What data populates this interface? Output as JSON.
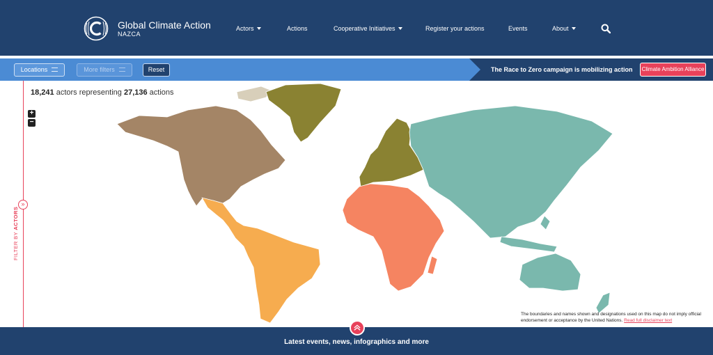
{
  "header": {
    "brand_title": "Global Climate Action",
    "brand_subtitle": "NAZCA",
    "nav": [
      {
        "label": "Actors",
        "dropdown": true
      },
      {
        "label": "Actions",
        "dropdown": false
      },
      {
        "label": "Cooperative Initiatives",
        "dropdown": true
      },
      {
        "label": "Register your actions",
        "dropdown": false
      },
      {
        "label": "Events",
        "dropdown": false
      },
      {
        "label": "About",
        "dropdown": true
      }
    ],
    "search_icon": "search-icon"
  },
  "filters": {
    "locations_label": "Locations",
    "more_filters_label": "More filters",
    "reset_label": "Reset",
    "campaign_text": "The Race to Zero campaign is mobilizing action",
    "alliance_label": "Climate Ambition Alliance"
  },
  "sidebar": {
    "label_prefix": "FILTER BY ",
    "label_emphasis": "ACTORS",
    "toggle_icon": "double-chevron-right-icon"
  },
  "stats": {
    "actors": "18,241",
    "actors_text": "actors representing",
    "actions": "27,136",
    "actions_text": "actions"
  },
  "zoom": {
    "in": "+",
    "out": "−"
  },
  "map": {
    "regions": [
      {
        "name": "North America",
        "color": "#a48566"
      },
      {
        "name": "Greenland",
        "color": "#8a8232"
      },
      {
        "name": "Latin America",
        "color": "#f6ac4f"
      },
      {
        "name": "Europe",
        "color": "#8a8232"
      },
      {
        "name": "Africa",
        "color": "#f58461"
      },
      {
        "name": "Asia-Pacific",
        "color": "#7ab8ad"
      },
      {
        "name": "Arctic islands",
        "color": "#d8cfba"
      }
    ]
  },
  "disclaimer": {
    "text": "The boundaries and names shown and designations used on this map do not imply official endorsement or acceptance by the United Nations.",
    "link": "Read full disclaimer text"
  },
  "bottom": {
    "label": "Latest events, news, infographics and more",
    "up_icon": "double-chevron-up-icon"
  },
  "colors": {
    "navy": "#21426e",
    "bar_blue": "#4b8bd4",
    "accent": "#e8415a"
  }
}
